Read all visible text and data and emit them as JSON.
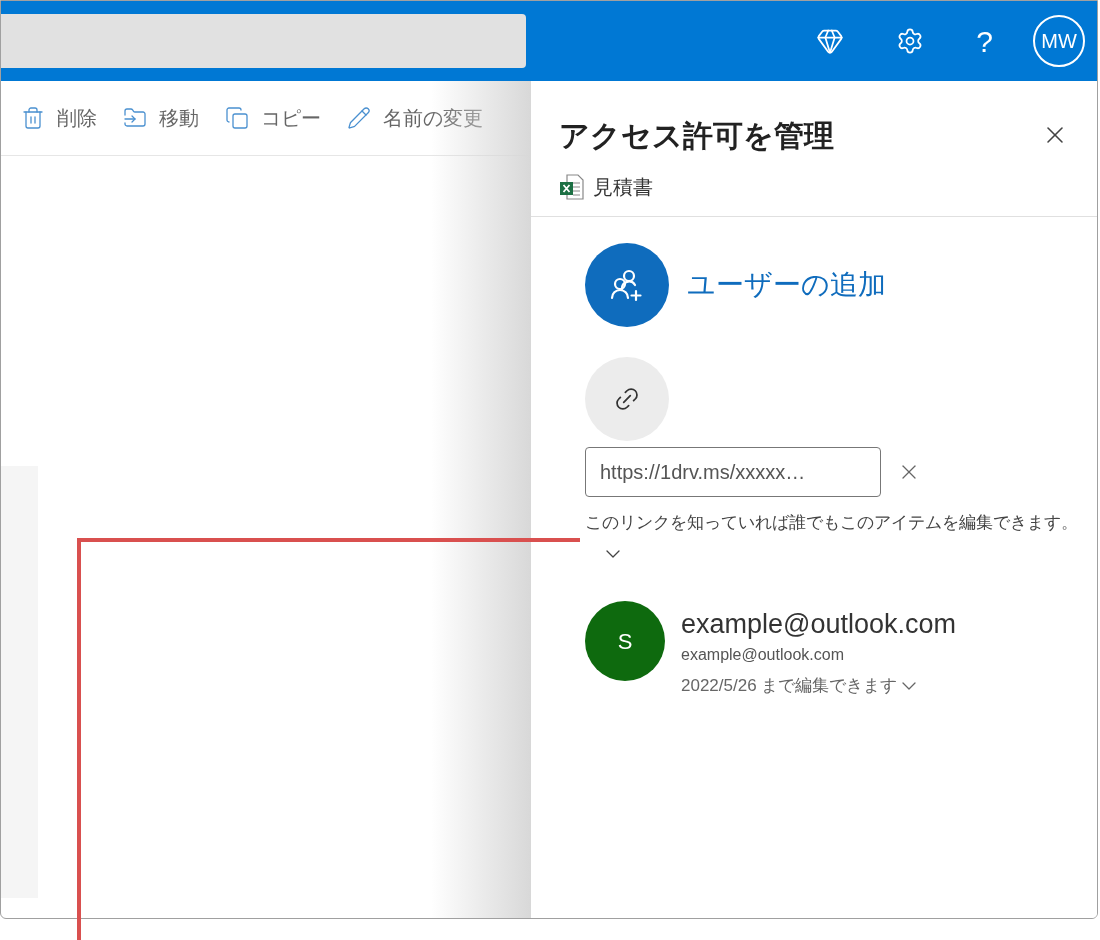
{
  "top_bar": {
    "help_label": "?",
    "avatar_initials": "MW"
  },
  "toolbar": [
    {
      "kind": "delete",
      "label": "削除"
    },
    {
      "kind": "move",
      "label": "移動"
    },
    {
      "kind": "copy",
      "label": "コピー"
    },
    {
      "kind": "rename",
      "label": "名前の変更"
    }
  ],
  "panel": {
    "title": "アクセス許可を管理",
    "file_name": "見積書",
    "add_user": "ユーザーの追加",
    "link": {
      "value": "https://1drv.ms/xxxxx…",
      "description": "このリンクを知っていれば誰でもこのアイテムを編集できます。"
    },
    "people": [
      {
        "initial": "S",
        "color": "#0e6a0e",
        "name": "example@outlook.com",
        "email": "example@outlook.com",
        "permission": "2022/5/26 まで編集できます"
      }
    ]
  }
}
